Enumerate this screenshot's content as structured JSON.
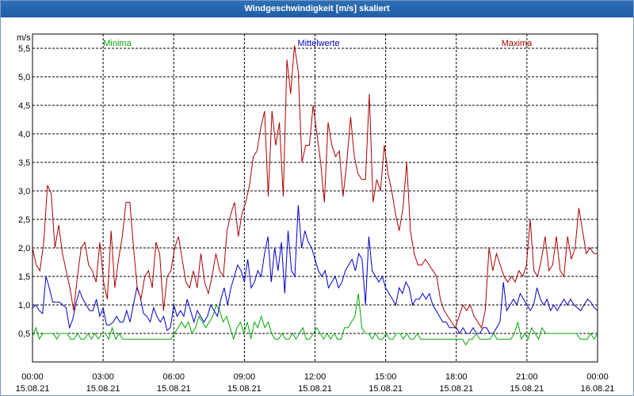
{
  "window": {
    "title": "Windgeschwindigkeit [m/s] skaliert"
  },
  "chart_data": {
    "type": "line",
    "title": "Windgeschwindigkeit [m/s] skaliert",
    "ylabel": "m/s",
    "xlabel": "",
    "ylim": [
      0,
      5.75
    ],
    "xlim_hours": [
      0,
      24
    ],
    "grid": true,
    "legend_placement": "top",
    "y_ticks": [
      "0,5",
      "1,0",
      "1,5",
      "2,0",
      "2,5",
      "3,0",
      "3,5",
      "4,0",
      "4,5",
      "5,0",
      "5,5"
    ],
    "x_ticks": [
      {
        "time": "00:00",
        "date": "15.08.21"
      },
      {
        "time": "03:00",
        "date": "15.08.21"
      },
      {
        "time": "06:00",
        "date": "15.08.21"
      },
      {
        "time": "09:00",
        "date": "15.08.21"
      },
      {
        "time": "12:00",
        "date": "15.08.21"
      },
      {
        "time": "15:00",
        "date": "15.08.21"
      },
      {
        "time": "18:00",
        "date": "15.08.21"
      },
      {
        "time": "21:00",
        "date": "15.08.21"
      },
      {
        "time": "00:00",
        "date": "16.08.21"
      }
    ],
    "series": [
      {
        "name": "Minima",
        "color": "#00aa00",
        "values": [
          0.45,
          0.6,
          0.4,
          0.5,
          0.5,
          0.5,
          0.5,
          0.4,
          0.5,
          0.5,
          0.5,
          0.4,
          0.4,
          0.5,
          0.4,
          0.4,
          0.5,
          0.4,
          0.5,
          0.4,
          0.5,
          0.5,
          0.4,
          0.6,
          0.4,
          0.5,
          0.4,
          0.4,
          0.4,
          0.4,
          0.4,
          0.4,
          0.4,
          0.4,
          0.4,
          0.4,
          0.4,
          0.4,
          0.4,
          0.4,
          0.4,
          0.5,
          0.6,
          0.7,
          0.6,
          0.7,
          0.5,
          0.6,
          0.8,
          0.7,
          0.6,
          0.7,
          0.8,
          1.0,
          0.9,
          0.7,
          0.8,
          0.6,
          0.4,
          0.6,
          0.7,
          0.5,
          0.7,
          0.4,
          0.7,
          0.6,
          0.8,
          0.6,
          0.7,
          0.5,
          0.4,
          0.4,
          0.5,
          0.4,
          0.4,
          0.5,
          0.4,
          0.5,
          0.6,
          0.4,
          0.4,
          0.5,
          0.6,
          0.5,
          0.4,
          0.5,
          0.4,
          0.5,
          0.4,
          0.4,
          0.6,
          0.6,
          0.7,
          0.8,
          1.2,
          0.6,
          0.5,
          0.5,
          0.4,
          0.5,
          0.4,
          0.4,
          0.5,
          0.4,
          0.4,
          0.5,
          0.5,
          0.4,
          0.5,
          0.4,
          0.4,
          0.5,
          0.4,
          0.4,
          0.4,
          0.4,
          0.4,
          0.4,
          0.4,
          0.4,
          0.4,
          0.4,
          0.4,
          0.4,
          0.4,
          0.3,
          0.4,
          0.4,
          0.5,
          0.4,
          0.4,
          0.4,
          0.4,
          0.5,
          0.4,
          0.4,
          0.4,
          0.4,
          0.4,
          0.5,
          0.7,
          0.4,
          0.5,
          0.4,
          0.6,
          0.5,
          0.4,
          0.6,
          0.5,
          0.5,
          0.5,
          0.5,
          0.5,
          0.5,
          0.5,
          0.5,
          0.5,
          0.5,
          0.4,
          0.4,
          0.4,
          0.5,
          0.4,
          0.5
        ]
      },
      {
        "name": "Mittelwerte",
        "color": "#0000cc",
        "values": [
          0.95,
          1.0,
          0.9,
          0.85,
          1.5,
          1.3,
          1.05,
          1.05,
          1.05,
          1.0,
          0.95,
          0.6,
          0.75,
          1.05,
          1.25,
          1.1,
          1.0,
          0.9,
          0.9,
          1.1,
          0.8,
          0.95,
          0.65,
          0.65,
          0.7,
          0.8,
          0.7,
          0.7,
          0.9,
          0.7,
          1.0,
          1.3,
          1.15,
          0.85,
          0.8,
          0.7,
          0.95,
          0.8,
          0.7,
          0.8,
          0.55,
          0.6,
          1.0,
          0.8,
          0.9,
          0.8,
          1.1,
          0.9,
          0.7,
          0.9,
          0.8,
          0.7,
          0.8,
          1.0,
          0.9,
          0.8,
          1.1,
          1.3,
          1.0,
          1.3,
          1.5,
          1.7,
          1.6,
          1.4,
          1.8,
          1.3,
          1.4,
          1.6,
          1.5,
          1.9,
          2.2,
          1.4,
          2.0,
          1.6,
          2.1,
          1.2,
          2.3,
          1.6,
          1.5,
          2.75,
          2.0,
          2.3,
          2.1,
          2.0,
          1.8,
          1.6,
          1.5,
          1.6,
          1.3,
          1.4,
          1.5,
          1.3,
          1.4,
          1.6,
          1.7,
          1.8,
          1.6,
          1.9,
          1.8,
          1.0,
          2.2,
          1.6,
          1.5,
          1.4,
          1.5,
          1.3,
          1.2,
          1.1,
          1.0,
          1.3,
          1.2,
          1.4,
          1.3,
          1.0,
          1.1,
          1.1,
          1.2,
          1.1,
          1.2,
          1.0,
          0.9,
          0.8,
          0.7,
          0.7,
          0.6,
          0.6,
          0.6,
          0.5,
          0.6,
          0.5,
          0.5,
          0.6,
          0.5,
          0.5,
          0.6,
          0.6,
          0.5,
          0.5,
          0.6,
          0.7,
          1.4,
          0.9,
          1.0,
          1.1,
          1.0,
          1.2,
          1.1,
          1.0,
          0.9,
          1.0,
          1.3,
          1.1,
          1.0,
          1.1,
          0.9,
          1.0,
          0.9,
          1.0,
          1.1,
          1.0,
          1.1,
          1.0,
          0.95,
          0.9,
          1.0,
          1.1,
          1.05,
          0.95,
          0.9
        ]
      },
      {
        "name": "Maxima",
        "color": "#aa0000",
        "values": [
          2.0,
          1.7,
          1.6,
          2.1,
          3.1,
          2.95,
          2.0,
          2.4,
          1.9,
          1.6,
          1.3,
          0.9,
          1.5,
          2.0,
          2.1,
          1.7,
          1.6,
          1.4,
          2.1,
          1.4,
          1.1,
          2.3,
          1.3,
          1.8,
          2.2,
          2.8,
          2.8,
          2.0,
          1.3,
          1.1,
          1.5,
          1.6,
          1.3,
          2.1,
          1.9,
          0.9,
          1.5,
          1.6,
          2.0,
          2.2,
          1.8,
          1.4,
          1.3,
          1.6,
          1.3,
          1.9,
          1.4,
          1.2,
          1.5,
          1.9,
          1.6,
          1.5,
          2.3,
          2.6,
          2.8,
          2.2,
          2.6,
          2.8,
          3.1,
          3.6,
          3.7,
          4.1,
          4.4,
          2.9,
          4.4,
          3.8,
          4.2,
          2.9,
          5.3,
          4.7,
          5.55,
          5.1,
          3.5,
          3.8,
          3.8,
          4.5,
          4.0,
          3.5,
          2.8,
          4.2,
          3.8,
          3.6,
          3.7,
          2.9,
          3.5,
          4.3,
          3.6,
          3.3,
          3.2,
          3.2,
          4.7,
          2.8,
          3.2,
          3.0,
          3.8,
          3.3,
          3.0,
          2.6,
          2.3,
          2.7,
          3.5,
          2.3,
          1.9,
          1.7,
          1.7,
          1.8,
          1.7,
          1.6,
          1.5,
          1.1,
          0.9,
          0.8,
          0.7,
          0.6,
          0.8,
          1.0,
          0.9,
          1.0,
          0.8,
          0.7,
          0.6,
          0.9,
          2.0,
          1.6,
          1.9,
          1.7,
          1.5,
          1.4,
          1.5,
          1.4,
          1.6,
          1.5,
          1.7,
          2.5,
          1.6,
          1.5,
          1.8,
          2.2,
          1.6,
          1.7,
          2.2,
          1.6,
          1.5,
          2.2,
          1.8,
          2.0,
          2.7,
          2.3,
          1.9,
          2.0,
          1.9,
          1.9
        ]
      }
    ]
  }
}
